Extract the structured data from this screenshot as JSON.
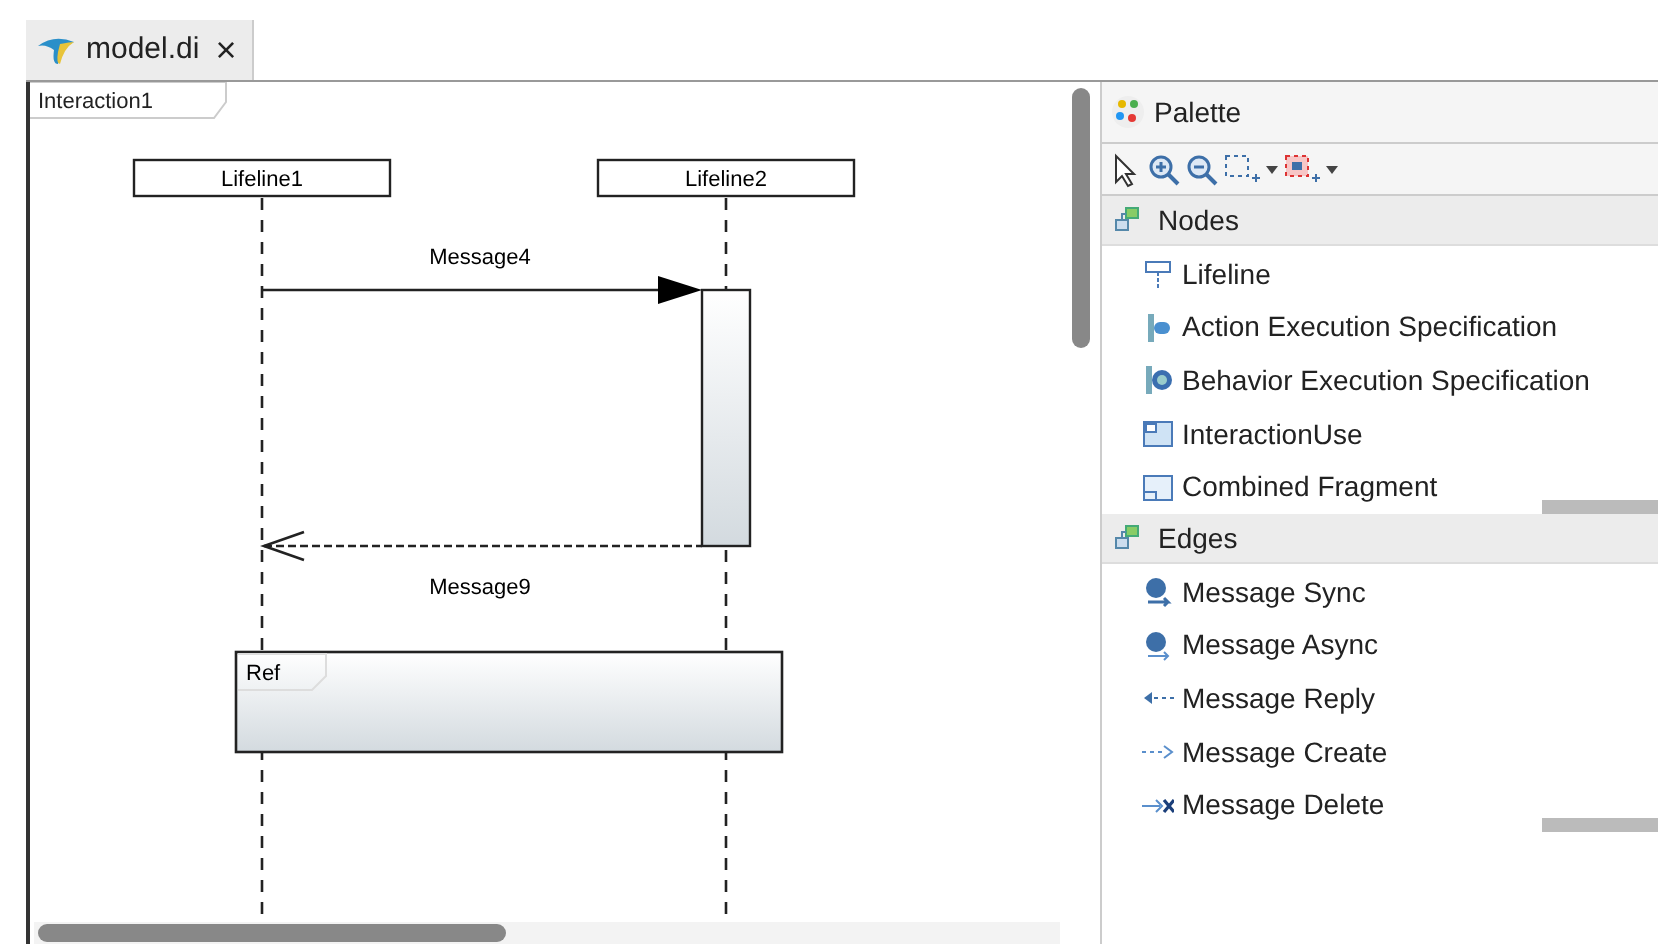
{
  "tab": {
    "title": "model.di",
    "close": "×"
  },
  "diagram": {
    "frame": "Interaction1",
    "lifelines": [
      {
        "name": "Lifeline1"
      },
      {
        "name": "Lifeline2"
      }
    ],
    "messages": [
      {
        "kind": "sync",
        "label": "Message4"
      },
      {
        "kind": "reply",
        "label": "Message9"
      }
    ],
    "fragments": [
      {
        "kind": "ref",
        "label": "Ref"
      }
    ]
  },
  "palette": {
    "title": "Palette",
    "groups": [
      {
        "title": "Nodes",
        "items": [
          {
            "kind": "lifeline",
            "label": "Lifeline"
          },
          {
            "kind": "action",
            "label": "Action Execution Specification"
          },
          {
            "kind": "behavior",
            "label": "Behavior Execution Specification"
          },
          {
            "kind": "use",
            "label": "InteractionUse"
          },
          {
            "kind": "fragment",
            "label": "Combined Fragment"
          }
        ]
      },
      {
        "title": "Edges",
        "items": [
          {
            "kind": "sync",
            "label": "Message Sync"
          },
          {
            "kind": "async",
            "label": "Message Async"
          },
          {
            "kind": "reply",
            "label": "Message Reply"
          },
          {
            "kind": "create",
            "label": "Message Create"
          },
          {
            "kind": "delete",
            "label": "Message Delete"
          }
        ]
      }
    ]
  }
}
